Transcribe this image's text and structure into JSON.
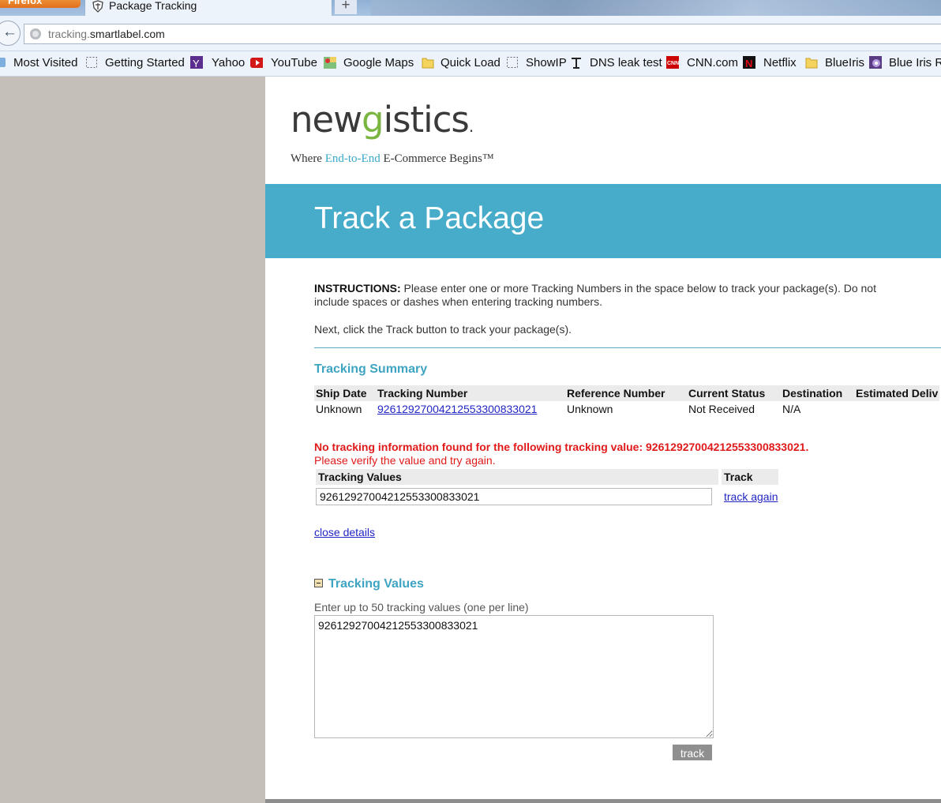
{
  "browser": {
    "menu_button": "Firefox",
    "tab_title": "Package Tracking",
    "new_tab_symbol": "+",
    "url_subdomain": "tracking.",
    "url_domain": "smartlabel.com",
    "bookmarks": [
      {
        "label": "Most Visited",
        "icon": "most-visited-icon"
      },
      {
        "label": "Getting Started",
        "icon": "dashed-page-icon"
      },
      {
        "label": "Yahoo",
        "icon": "yahoo-icon"
      },
      {
        "label": "YouTube",
        "icon": "youtube-icon"
      },
      {
        "label": "Google Maps",
        "icon": "google-maps-icon"
      },
      {
        "label": "Quick Load",
        "icon": "folder-icon"
      },
      {
        "label": "ShowIP",
        "icon": "dashed-page-icon"
      },
      {
        "label": "DNS leak test",
        "icon": "dns-icon"
      },
      {
        "label": "CNN.com",
        "icon": "cnn-icon"
      },
      {
        "label": "Netflix",
        "icon": "netflix-icon"
      },
      {
        "label": "BlueIris",
        "icon": "folder-icon"
      },
      {
        "label": "Blue Iris R",
        "icon": "blue-iris-icon"
      }
    ]
  },
  "logo": {
    "word_start": "new",
    "word_mid": "g",
    "word_end": "istics",
    "registered": ".",
    "tag_start": "Where ",
    "tag_highlight": "End-to-End",
    "tag_end": " E-Commerce Begins™"
  },
  "hero": {
    "title": "Track a Package"
  },
  "instructions": {
    "label": "INSTRUCTIONS:",
    "text": " Please enter one or more Tracking Numbers in the space below to track your package(s). Do not include spaces or dashes when entering tracking numbers.",
    "next": "Next, click the Track button to track your package(s)."
  },
  "summary": {
    "title": "Tracking Summary",
    "headers": [
      "Ship Date",
      "Tracking Number",
      "Reference Number",
      "Current Status",
      "Destination",
      "Estimated Deliv"
    ],
    "row": {
      "ship_date": "Unknown",
      "tracking_number": "9261292700421255330083302​1",
      "reference_number": "Unknown",
      "current_status": "Not Received",
      "destination": "N/A",
      "estimated_delivery": ""
    }
  },
  "error": {
    "line1": "No tracking information found for the following tracking value: 92612927004212553300833021.",
    "line2": "Please verify the value and try again."
  },
  "values_table": {
    "header_values": "Tracking Values",
    "header_track": "Track",
    "input_value": "92612927004212553300833021",
    "track_again": "track again"
  },
  "close_details": "close details",
  "tracking_values": {
    "title": "Tracking Values",
    "hint": "Enter up to 50 tracking values (one per line)",
    "textarea_value": "92612927004212553300833021",
    "button": "track"
  },
  "colors": {
    "brand_blue": "#46acca",
    "link": "#2226c4",
    "error_red": "#e01a1a",
    "logo_green": "#7ab441"
  }
}
